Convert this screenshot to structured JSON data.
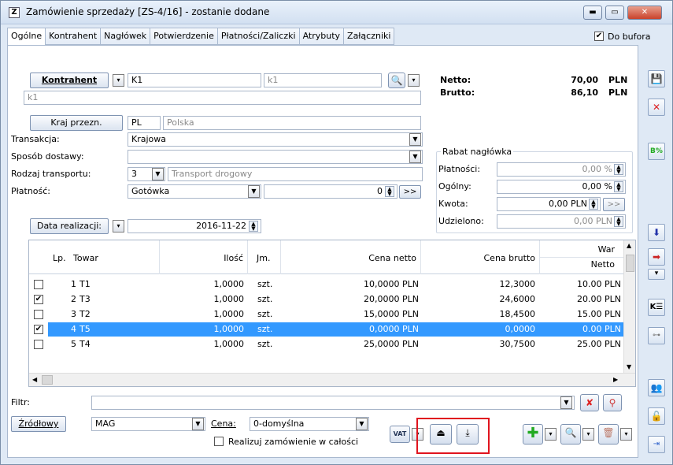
{
  "window": {
    "title": "Zamówienie sprzedaży [ZS-4/16] - zostanie dodane",
    "icon_text": "Z"
  },
  "tabs": [
    "Ogólne",
    "Kontrahent",
    "Nagłówek",
    "Potwierdzenie",
    "Płatności/Zaliczki",
    "Atrybuty",
    "Załączniki"
  ],
  "do_bufora": {
    "label": "Do bufora",
    "checked": true
  },
  "kontrahent": {
    "button_label": "Kontrahent",
    "code": "K1",
    "code_gray": "k1",
    "name": "k1"
  },
  "totals": {
    "netto_label": "Netto:",
    "netto_value": "70,00",
    "brutto_label": "Brutto:",
    "brutto_value": "86,10",
    "currency": "PLN"
  },
  "kraj": {
    "button_label": "Kraj przezn.",
    "code": "PL",
    "name": "Polska"
  },
  "transakcja": {
    "label": "Transakcja:",
    "value": "Krajowa"
  },
  "sposob_dostawy": {
    "label": "Sposób dostawy:",
    "value": ""
  },
  "rodzaj_transportu": {
    "label": "Rodzaj transportu:",
    "code": "3",
    "name": "Transport drogowy"
  },
  "platnosc": {
    "label": "Płatność:",
    "value": "Gotówka",
    "days": "0",
    "more": ">>"
  },
  "rabat": {
    "title": "Rabat nagłówka",
    "platnosci_label": "Płatności:",
    "platnosci_value": "0,00 %",
    "ogolny_label": "Ogólny:",
    "ogolny_value": "0,00 %",
    "kwota_label": "Kwota:",
    "kwota_value": "0,00 PLN",
    "kwota_more": ">>",
    "udzielono_label": "Udzielono:",
    "udzielono_value": "0,00 PLN"
  },
  "data_realizacji": {
    "button_label": "Data realizacji:",
    "value": "2016-11-22"
  },
  "table": {
    "headers": {
      "lp": "Lp.",
      "towar": "Towar",
      "ilosc": "Ilość",
      "jm": "Jm.",
      "cena_netto": "Cena netto",
      "cena_brutto": "Cena brutto",
      "war": "War",
      "netto": "Netto"
    },
    "rows": [
      {
        "checked": false,
        "lp": "1",
        "towar": "T1",
        "ilosc": "1,0000",
        "jm": "szt.",
        "cena_netto": "10,0000 PLN",
        "cena_brutto": "12,3000",
        "wartosc": "10.00 PLN",
        "selected": false
      },
      {
        "checked": true,
        "lp": "2",
        "towar": "T3",
        "ilosc": "1,0000",
        "jm": "szt.",
        "cena_netto": "20,0000 PLN",
        "cena_brutto": "24,6000",
        "wartosc": "20.00 PLN",
        "selected": false
      },
      {
        "checked": false,
        "lp": "3",
        "towar": "T2",
        "ilosc": "1,0000",
        "jm": "szt.",
        "cena_netto": "15,0000 PLN",
        "cena_brutto": "18,4500",
        "wartosc": "15.00 PLN",
        "selected": false
      },
      {
        "checked": true,
        "lp": "4",
        "towar": "T5",
        "ilosc": "1,0000",
        "jm": "szt.",
        "cena_netto": "0,0000 PLN",
        "cena_brutto": "0,0000",
        "wartosc": "0.00 PLN",
        "selected": true
      },
      {
        "checked": false,
        "lp": "5",
        "towar": "T4",
        "ilosc": "1,0000",
        "jm": "szt.",
        "cena_netto": "25,0000 PLN",
        "cena_brutto": "30,7500",
        "wartosc": "25.00 PLN",
        "selected": false
      }
    ]
  },
  "filtr": {
    "label": "Filtr:",
    "value": ""
  },
  "bottom": {
    "zrodlowy_label": "Źródłowy",
    "magazyn": "MAG",
    "cena_label": "Cena:",
    "cena_value": "0-domyślna",
    "realizuj_label": "Realizuj zamówienie w całości",
    "vat_label": "VAT"
  },
  "colors": {
    "selection": "#3399ff",
    "highlight_box": "#e0141e",
    "window_bg": "#dfe9f5"
  }
}
